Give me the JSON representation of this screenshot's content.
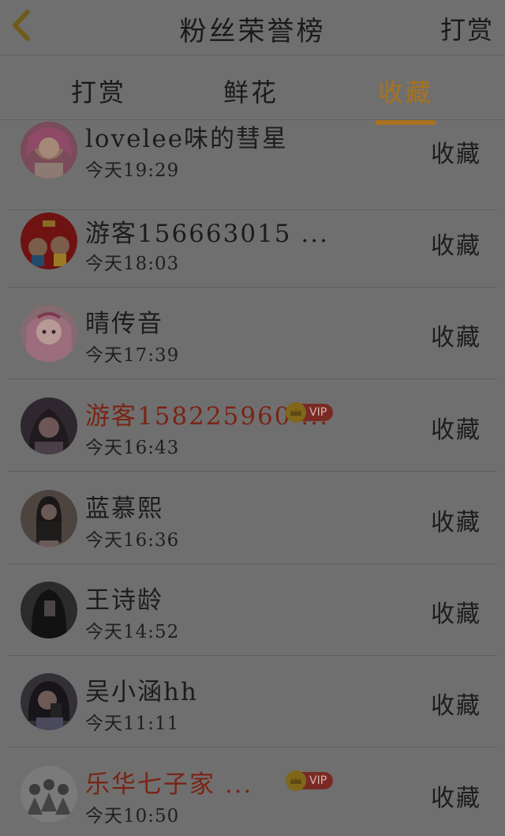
{
  "header": {
    "title": "粉丝荣誉榜",
    "reward_label": "打赏"
  },
  "tabs": [
    {
      "label": "打赏",
      "active": false
    },
    {
      "label": "鲜花",
      "active": false
    },
    {
      "label": "收藏",
      "active": true
    }
  ],
  "colors": {
    "accent": "#a8721f",
    "vip_name": "#7a2414",
    "overlay_bg": "#6f6f6f"
  },
  "fans": [
    {
      "name": "lovelee味的彗星",
      "time": "今天19:29",
      "action": "收藏",
      "vip": false,
      "avatar_icon": "pink-hair-girl-avatar"
    },
    {
      "name": "游客156663015 ...",
      "time": "今天18:03",
      "action": "收藏",
      "vip": false,
      "avatar_icon": "red-cartoon-couple-avatar"
    },
    {
      "name": "晴传音",
      "time": "今天17:39",
      "action": "收藏",
      "vip": false,
      "avatar_icon": "anime-girl-avatar"
    },
    {
      "name": "游客158225960 ...",
      "time": "今天16:43",
      "action": "收藏",
      "vip": true,
      "vip_label": "VIP",
      "avatar_icon": "girl-photo-avatar"
    },
    {
      "name": "蓝慕熙",
      "time": "今天16:36",
      "action": "收藏",
      "vip": false,
      "avatar_icon": "girl-sitting-avatar"
    },
    {
      "name": "王诗龄",
      "time": "今天14:52",
      "action": "收藏",
      "vip": false,
      "avatar_icon": "dark-hair-girl-avatar"
    },
    {
      "name": "吴小涵hh",
      "time": "今天11:11",
      "action": "收藏",
      "vip": false,
      "avatar_icon": "girl-with-phone-avatar"
    },
    {
      "name": "乐华七子家 ...",
      "time": "今天10:50",
      "action": "收藏",
      "vip": true,
      "vip_label": "VIP",
      "avatar_icon": "group-sketch-avatar"
    }
  ]
}
